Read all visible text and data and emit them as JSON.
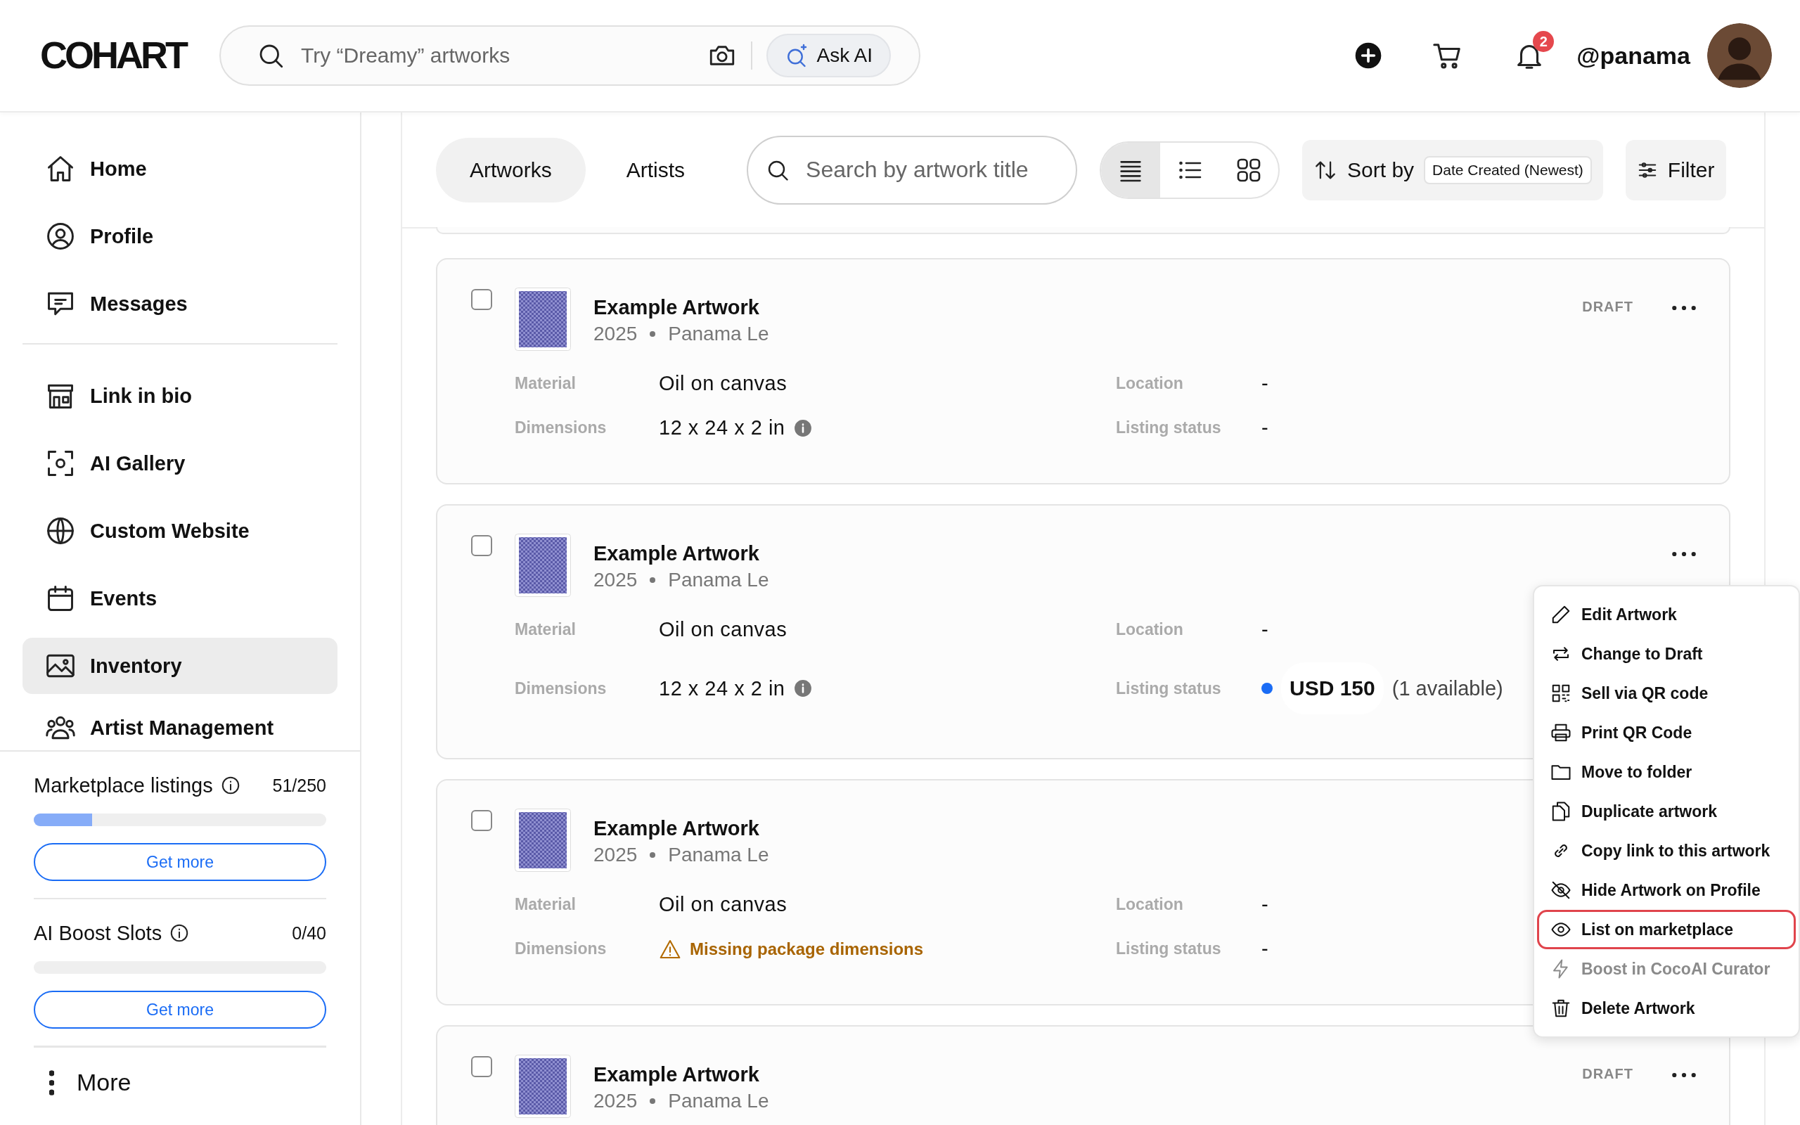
{
  "header": {
    "logo": "COHART",
    "search": {
      "placeholder": "Try “Dreamy” artworks"
    },
    "ask_ai": "Ask AI",
    "notifications": {
      "badge": "2"
    },
    "username": "@panama"
  },
  "sidebar": {
    "groups": [
      [
        {
          "label": "Home",
          "selected": false
        },
        {
          "label": "Profile",
          "selected": false
        },
        {
          "label": "Messages",
          "selected": false
        }
      ],
      [
        {
          "label": "Link in bio",
          "selected": false
        },
        {
          "label": "AI Gallery",
          "selected": false
        },
        {
          "label": "Custom Website",
          "selected": false
        },
        {
          "label": "Events",
          "selected": false
        },
        {
          "label": "Inventory",
          "selected": true
        },
        {
          "label": "Artist Management",
          "selected": false
        }
      ]
    ],
    "quotas": [
      {
        "label": "Marketplace listings",
        "count": "51/250",
        "level": 0.2,
        "button": "Get more"
      },
      {
        "label": "AI Boost Slots",
        "count": "0/40",
        "level": 0,
        "button": "Get more"
      }
    ],
    "more": "More"
  },
  "toolbar": {
    "tabs": [
      {
        "label": "Artworks",
        "selected": true
      },
      {
        "label": "Artists",
        "selected": false
      }
    ],
    "search": {
      "placeholder": "Search by artwork title"
    },
    "views": [
      {
        "selected": true
      },
      {
        "selected": false
      },
      {
        "selected": false
      }
    ],
    "sort": {
      "label": "Sort by",
      "value": "Date Created (Newest)"
    },
    "filter": "Filter"
  },
  "cards": [
    {
      "title": "Example Artwork",
      "year": "2025",
      "artist": "Panama Le",
      "badge": "DRAFT",
      "menu_button": true,
      "checked": false,
      "fields": {
        "material_label": "Material",
        "material": "Oil on canvas",
        "dimensions_label": "Dimensions",
        "dimensions": {
          "kind": "value",
          "text": "12 x 24 x 2 in"
        },
        "location_label": "Location",
        "location": "-",
        "listing_label": "Listing status",
        "listing": {
          "kind": "none",
          "text": "-"
        }
      }
    },
    {
      "title": "Example Artwork",
      "year": "2025",
      "artist": "Panama Le",
      "menu_button": true,
      "checked": false,
      "fields": {
        "material_label": "Material",
        "material": "Oil on canvas",
        "dimensions_label": "Dimensions",
        "dimensions": {
          "kind": "value",
          "text": "12 x 24 x 2 in"
        },
        "location_label": "Location",
        "location": "-",
        "listing_label": "Listing status",
        "listing": {
          "kind": "price",
          "price": "USD 150",
          "availability": "(1 available)",
          "color": "#1a6cf5"
        }
      }
    },
    {
      "title": "Example Artwork",
      "year": "2025",
      "artist": "Panama Le",
      "menu_button": false,
      "checked": false,
      "fields": {
        "material_label": "Material",
        "material": "Oil on canvas",
        "dimensions_label": "Dimensions",
        "dimensions": {
          "kind": "warning",
          "text": "Missing package dimensions"
        },
        "location_label": "Location",
        "location": "-",
        "listing_label": "Listing status",
        "listing": {
          "kind": "none",
          "text": "-"
        }
      }
    },
    {
      "title": "Example Artwork",
      "year": "2025",
      "artist": "Panama Le",
      "badge": "DRAFT",
      "menu_button": true,
      "checked": false
    }
  ],
  "menu": {
    "items": [
      {
        "label": "Edit Artwork",
        "disabled": false,
        "highlighted": false
      },
      {
        "label": "Change to Draft",
        "disabled": false,
        "highlighted": false
      },
      {
        "label": "Sell via QR code",
        "disabled": false,
        "highlighted": false
      },
      {
        "label": "Print QR Code",
        "disabled": false,
        "highlighted": false
      },
      {
        "label": "Move to folder",
        "disabled": false,
        "highlighted": false
      },
      {
        "label": "Duplicate artwork",
        "disabled": false,
        "highlighted": false
      },
      {
        "label": "Copy link to this artwork",
        "disabled": false,
        "highlighted": false
      },
      {
        "label": "Hide Artwork on Profile",
        "disabled": false,
        "highlighted": false
      },
      {
        "label": "List on marketplace",
        "disabled": false,
        "highlighted": true
      },
      {
        "label": "Boost in CocoAI Curator",
        "disabled": true,
        "highlighted": false
      },
      {
        "label": "Delete Artwork",
        "disabled": false,
        "highlighted": false
      }
    ]
  }
}
